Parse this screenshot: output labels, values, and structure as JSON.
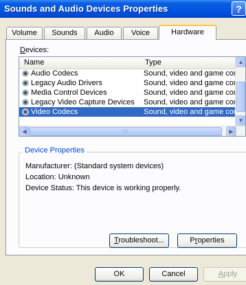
{
  "window": {
    "title": "Sounds and Audio Devices Properties",
    "help_label": "?"
  },
  "tabs": [
    {
      "label": "Volume"
    },
    {
      "label": "Sounds"
    },
    {
      "label": "Audio"
    },
    {
      "label": "Voice"
    },
    {
      "label": "Hardware"
    }
  ],
  "devices": {
    "label_accel": "D",
    "label_rest": "evices:",
    "columns": [
      "Name",
      "Type"
    ],
    "rows": [
      {
        "name": "Audio Codecs",
        "type": "Sound, video and game controllers"
      },
      {
        "name": "Legacy Audio Drivers",
        "type": "Sound, video and game controllers"
      },
      {
        "name": "Media Control Devices",
        "type": "Sound, video and game controllers"
      },
      {
        "name": "Legacy Video Capture Devices",
        "type": "Sound, video and game controllers"
      },
      {
        "name": "Video Codecs",
        "type": "Sound, video and game controllers"
      }
    ]
  },
  "properties": {
    "group_title": "Device Properties",
    "manufacturer": "Manufacturer: (Standard system devices)",
    "location": "Location: Unknown",
    "status": "Device Status: This device is working properly."
  },
  "buttons": {
    "troubleshoot_accel": "T",
    "troubleshoot_rest": "roubleshoot...",
    "properties_pre": "P",
    "properties_accel": "r",
    "properties_rest": "operties",
    "ok": "OK",
    "cancel": "Cancel",
    "apply_accel": "A",
    "apply_rest": "pply"
  }
}
